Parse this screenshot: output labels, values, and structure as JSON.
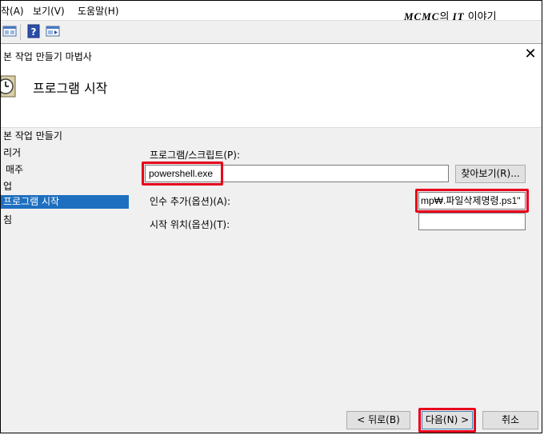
{
  "menubar": {
    "items": [
      "작(A)",
      "보기(V)",
      "도움말(H)"
    ],
    "watermark_brand": "MCMC",
    "watermark_mid": "의 ",
    "watermark_it": "IT",
    "watermark_tail": " 이야기"
  },
  "dialog": {
    "title": "본 작업 만들기 마법사",
    "close": "✕",
    "heading": "프로그램 시작"
  },
  "steps": [
    "본 작업 만들기",
    "리거",
    "매주",
    "업",
    "프로그램 시작",
    "침"
  ],
  "form": {
    "program_label": "프로그램/스크립트(P):",
    "program_value": "powershell.exe",
    "browse_label": "찾아보기(R)...",
    "args_label": "인수 추가(옵션)(A):",
    "args_value": "mp₩.파일삭제명령.ps1\"",
    "start_label": "시작 위치(옵션)(T):",
    "start_value": ""
  },
  "buttons": {
    "back": "< 뒤로(B)",
    "next": "다음(N) >",
    "cancel": "취소"
  },
  "colors": {
    "accent": "#1e6fbf",
    "highlight": "#e8001c"
  }
}
